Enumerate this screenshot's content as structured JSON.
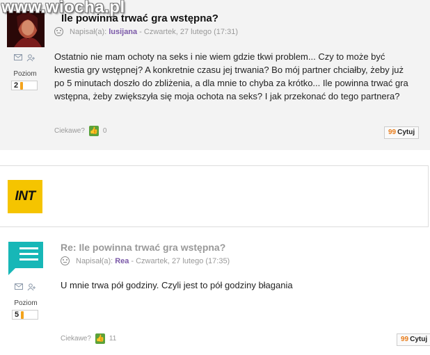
{
  "watermark": "www.wiocha.pl",
  "colors": {
    "author": "#7b59a8",
    "level_bar": "#f3a31d",
    "thumb": "#5aa23a",
    "ad_bg": "#f5c400",
    "reply_avatar": "#17b7b7"
  },
  "post1": {
    "title": "Ile powinna trwać gra wstępna?",
    "title_visible": "... trwać gra wstępna?",
    "meta_prefix": "Napisał(a):",
    "author": "lusijana",
    "date": "- Czwartek, 27 lutego (17:31)",
    "level_label": "Poziom",
    "level": "2",
    "level_fraction": 0.2,
    "body": "Ostatnio nie mam ochoty na seks i nie wiem gdzie tkwi problem... Czy to może być kwestia gry wstępnej? A konkretnie czasu jej trwania? Bo mój partner chciałby, żeby już po 5 minutach doszło do zbliżenia, a dla mnie to chyba za krótko... Ile powinna trwać gra wstępna, żeby zwiększyła się moja ochota na seks? I jak przekonać do tego partnera?",
    "ciekawe_label": "Ciekawe?",
    "likes": "0",
    "quote_label": "Cytuj",
    "icons": [
      "envelope-icon",
      "add-friend-icon",
      "smiley-icon",
      "thumb-up-icon",
      "quote-icon"
    ]
  },
  "ad": {
    "logo_text": "INT"
  },
  "post2": {
    "title": "Re: Ile powinna trwać gra wstępna?",
    "meta_prefix": "Napisał(a):",
    "author": "Rea",
    "date": "- Czwartek, 27 lutego (17:35)",
    "level_label": "Poziom",
    "level": "5",
    "level_fraction": 0.2,
    "body": "U mnie trwa pół godziny. Czyli jest to pół godziny błagania",
    "ciekawe_label": "Ciekawe?",
    "likes": "11",
    "quote_label": "Cytuj",
    "icons": [
      "chat-bubble-icon",
      "envelope-icon",
      "add-friend-icon",
      "smiley-icon",
      "thumb-up-icon",
      "quote-icon"
    ]
  }
}
